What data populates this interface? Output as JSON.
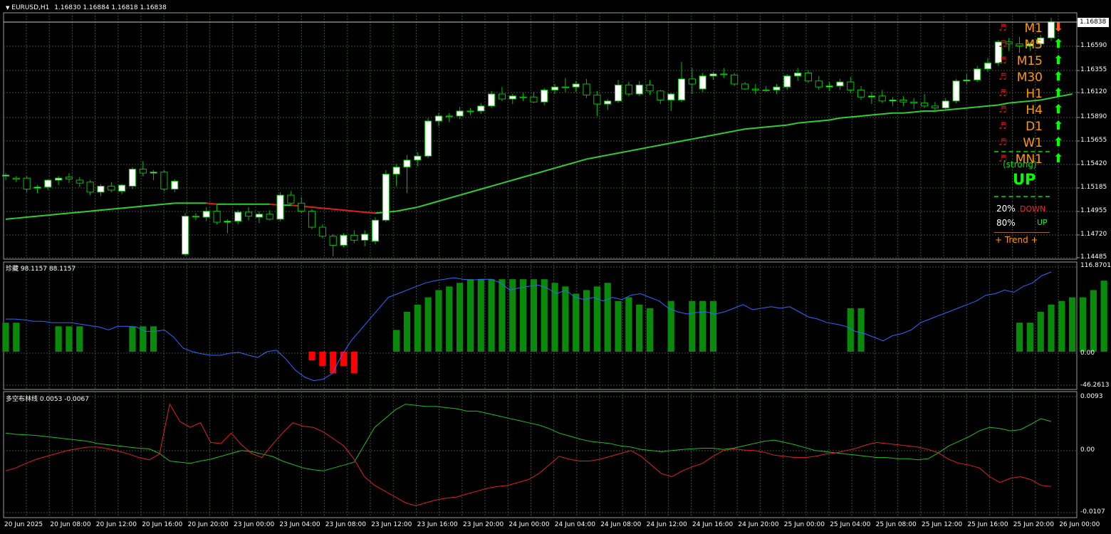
{
  "header": {
    "symbol": "EURUSD,H1",
    "ohlc": "1.16830 1.16884 1.16818 1.16838"
  },
  "colors": {
    "grid": "#3b4f3b",
    "frame": "#9a9a9a",
    "bull": "#ffffff",
    "bear": "#000000",
    "wick": "#00c000",
    "ma_up": "#33cc33",
    "ma_down": "#e02020",
    "blue": "#3366ff",
    "hist_up": "#0a8a0a",
    "hist_down": "#ff0000",
    "green_line": "#22bb22",
    "red_line": "#dd2222",
    "orange": "#ff9900",
    "arrow_up": "#00ff00",
    "arrow_down": "#ff5a1a"
  },
  "main": {
    "price_labels": [
      "1.16838",
      "1.16590",
      "1.16355",
      "1.16120",
      "1.15890",
      "1.15655",
      "1.15420",
      "1.15185",
      "1.14955",
      "1.14720",
      "1.14485"
    ],
    "current_price": "1.16838",
    "panel": {
      "timeframes": [
        {
          "label": "M1",
          "arrow": "down"
        },
        {
          "label": "M5",
          "arrow": "up"
        },
        {
          "label": "M15",
          "arrow": "up"
        },
        {
          "label": "M30",
          "arrow": "up"
        },
        {
          "label": "H1",
          "arrow": "up"
        },
        {
          "label": "H4",
          "arrow": "up"
        },
        {
          "label": "D1",
          "arrow": "up"
        },
        {
          "label": "W1",
          "arrow": "up"
        },
        {
          "label": "MN1",
          "arrow": "up"
        }
      ],
      "music_icon": "♬",
      "strength": "(strong)",
      "direction": "UP",
      "down_pct": "20%",
      "down_label": "DOWN",
      "up_pct": "80%",
      "up_label": "UP",
      "trend": "+  Trend  +"
    }
  },
  "ind1": {
    "title": "珍藏 98.1157 88.1157",
    "labels": [
      "116.8701",
      "0.00",
      "-46.2613"
    ]
  },
  "ind2": {
    "title": "多空布林线 0.0053 -0.0067",
    "labels": [
      "0.0093",
      "0.00",
      "-0.0107"
    ]
  },
  "time_labels": [
    "20 Jun 2025",
    "20 Jun 08:00",
    "20 Jun 12:00",
    "20 Jun 16:00",
    "20 Jun 20:00",
    "23 Jun 00:00",
    "23 Jun 04:00",
    "23 Jun 08:00",
    "23 Jun 12:00",
    "23 Jun 16:00",
    "23 Jun 20:00",
    "24 Jun 00:00",
    "24 Jun 04:00",
    "24 Jun 08:00",
    "24 Jun 12:00",
    "24 Jun 16:00",
    "24 Jun 20:00",
    "25 Jun 00:00",
    "25 Jun 04:00",
    "25 Jun 08:00",
    "25 Jun 12:00",
    "25 Jun 16:00",
    "25 Jun 20:00",
    "26 Jun 00:00"
  ],
  "chart_data": {
    "type": "candlestick",
    "ylim": [
      1.14485,
      1.16838
    ],
    "candles": [
      [
        1.153,
        1.1533,
        1.1526,
        1.1531
      ],
      [
        1.1528,
        1.153,
        1.1524,
        1.1527
      ],
      [
        1.1528,
        1.153,
        1.1514,
        1.1517
      ],
      [
        1.1518,
        1.1521,
        1.1513,
        1.1519
      ],
      [
        1.1519,
        1.1527,
        1.1516,
        1.1526
      ],
      [
        1.1526,
        1.153,
        1.1521,
        1.1528
      ],
      [
        1.1529,
        1.1533,
        1.1523,
        1.1527
      ],
      [
        1.1526,
        1.1529,
        1.1519,
        1.1523
      ],
      [
        1.1524,
        1.1526,
        1.1511,
        1.1514
      ],
      [
        1.1514,
        1.1522,
        1.151,
        1.152
      ],
      [
        1.152,
        1.1524,
        1.1514,
        1.1516
      ],
      [
        1.1515,
        1.1522,
        1.1512,
        1.1521
      ],
      [
        1.152,
        1.1539,
        1.1517,
        1.1537
      ],
      [
        1.1537,
        1.1545,
        1.153,
        1.1533
      ],
      [
        1.1533,
        1.1536,
        1.1526,
        1.1534
      ],
      [
        1.1534,
        1.1536,
        1.1515,
        1.1517
      ],
      [
        1.1517,
        1.1527,
        1.1514,
        1.1525
      ],
      [
        1.1452,
        1.1493,
        1.145,
        1.149
      ],
      [
        1.149,
        1.1493,
        1.1486,
        1.149
      ],
      [
        1.1489,
        1.1499,
        1.1485,
        1.1495
      ],
      [
        1.1495,
        1.1502,
        1.1482,
        1.1484
      ],
      [
        1.1484,
        1.1487,
        1.1473,
        1.1485
      ],
      [
        1.1485,
        1.1496,
        1.1482,
        1.1494
      ],
      [
        1.1494,
        1.1499,
        1.1486,
        1.149
      ],
      [
        1.1489,
        1.1495,
        1.1483,
        1.1492
      ],
      [
        1.1492,
        1.1496,
        1.1486,
        1.1487
      ],
      [
        1.1487,
        1.1514,
        1.1485,
        1.1511
      ],
      [
        1.1511,
        1.1515,
        1.15,
        1.1503
      ],
      [
        1.1503,
        1.1509,
        1.1493,
        1.1495
      ],
      [
        1.1495,
        1.1497,
        1.1477,
        1.1479
      ],
      [
        1.1479,
        1.1482,
        1.1468,
        1.147
      ],
      [
        1.147,
        1.1472,
        1.145,
        1.1461
      ],
      [
        1.1461,
        1.1473,
        1.1459,
        1.1471
      ],
      [
        1.1471,
        1.1476,
        1.1463,
        1.1466
      ],
      [
        1.1466,
        1.1476,
        1.146,
        1.1472
      ],
      [
        1.1465,
        1.1489,
        1.1462,
        1.1486
      ],
      [
        1.1486,
        1.1536,
        1.1484,
        1.1532
      ],
      [
        1.1532,
        1.1542,
        1.152,
        1.1539
      ],
      [
        1.1539,
        1.1551,
        1.1513,
        1.1546
      ],
      [
        1.1546,
        1.1554,
        1.154,
        1.155
      ],
      [
        1.155,
        1.1588,
        1.1548,
        1.1585
      ],
      [
        1.1585,
        1.1593,
        1.158,
        1.159
      ],
      [
        1.159,
        1.1593,
        1.1584,
        1.159
      ],
      [
        1.159,
        1.1599,
        1.1587,
        1.1595
      ],
      [
        1.1595,
        1.1598,
        1.1591,
        1.1595
      ],
      [
        1.1595,
        1.1603,
        1.1592,
        1.16
      ],
      [
        1.16,
        1.1615,
        1.1598,
        1.1612
      ],
      [
        1.1612,
        1.1619,
        1.1605,
        1.1607
      ],
      [
        1.1607,
        1.1612,
        1.1602,
        1.161
      ],
      [
        1.1609,
        1.1613,
        1.1605,
        1.1609
      ],
      [
        1.1609,
        1.1614,
        1.1603,
        1.1604
      ],
      [
        1.1604,
        1.1618,
        1.1601,
        1.1616
      ],
      [
        1.1616,
        1.1622,
        1.1612,
        1.1619
      ],
      [
        1.1619,
        1.1628,
        1.1614,
        1.1619
      ],
      [
        1.1619,
        1.1625,
        1.1614,
        1.1622
      ],
      [
        1.1622,
        1.1627,
        1.1608,
        1.1611
      ],
      [
        1.1611,
        1.1615,
        1.159,
        1.1602
      ],
      [
        1.1602,
        1.1607,
        1.1596,
        1.1605
      ],
      [
        1.1605,
        1.1626,
        1.1603,
        1.1621
      ],
      [
        1.1621,
        1.1624,
        1.161,
        1.1612
      ],
      [
        1.1612,
        1.1625,
        1.161,
        1.1621
      ],
      [
        1.1621,
        1.1626,
        1.1611,
        1.1615
      ],
      [
        1.1615,
        1.1616,
        1.1602,
        1.1606
      ],
      [
        1.1606,
        1.1613,
        1.1595,
        1.1612
      ],
      [
        1.1606,
        1.1644,
        1.1604,
        1.1627
      ],
      [
        1.1627,
        1.1638,
        1.1612,
        1.1622
      ],
      [
        1.1617,
        1.1633,
        1.1614,
        1.163
      ],
      [
        1.163,
        1.1634,
        1.1626,
        1.1632
      ],
      [
        1.1632,
        1.1638,
        1.1628,
        1.1632
      ],
      [
        1.1631,
        1.1633,
        1.162,
        1.1622
      ],
      [
        1.1622,
        1.1624,
        1.1616,
        1.1617
      ],
      [
        1.1617,
        1.1622,
        1.1612,
        1.1616
      ],
      [
        1.1616,
        1.162,
        1.1614,
        1.1616
      ],
      [
        1.1616,
        1.1622,
        1.1612,
        1.1619
      ],
      [
        1.1619,
        1.1632,
        1.1616,
        1.163
      ],
      [
        1.163,
        1.1638,
        1.1625,
        1.1633
      ],
      [
        1.1633,
        1.1636,
        1.1623,
        1.1625
      ],
      [
        1.1625,
        1.163,
        1.1616,
        1.1619
      ],
      [
        1.1619,
        1.1624,
        1.1615,
        1.162
      ],
      [
        1.162,
        1.1627,
        1.1616,
        1.1624
      ],
      [
        1.1624,
        1.1629,
        1.1613,
        1.1616
      ],
      [
        1.1616,
        1.162,
        1.1606,
        1.1609
      ],
      [
        1.1609,
        1.1614,
        1.1602,
        1.161
      ],
      [
        1.161,
        1.1616,
        1.1603,
        1.1605
      ],
      [
        1.1605,
        1.1609,
        1.16,
        1.1606
      ],
      [
        1.1606,
        1.161,
        1.16,
        1.1604
      ],
      [
        1.1604,
        1.1608,
        1.1597,
        1.1603
      ],
      [
        1.1603,
        1.1612,
        1.1598,
        1.16
      ],
      [
        1.16,
        1.1604,
        1.1594,
        1.1598
      ],
      [
        1.1598,
        1.1608,
        1.1595,
        1.1605
      ],
      [
        1.1605,
        1.1627,
        1.1603,
        1.1625
      ],
      [
        1.1625,
        1.1632,
        1.1622,
        1.1626
      ],
      [
        1.1626,
        1.164,
        1.1624,
        1.1637
      ],
      [
        1.1637,
        1.1648,
        1.1634,
        1.1643
      ],
      [
        1.1643,
        1.1666,
        1.164,
        1.1664
      ],
      [
        1.1664,
        1.1668,
        1.1655,
        1.1662
      ],
      [
        1.1662,
        1.1669,
        1.1653,
        1.166
      ],
      [
        1.166,
        1.1664,
        1.1655,
        1.1662
      ],
      [
        1.1662,
        1.1671,
        1.1658,
        1.1668
      ],
      [
        1.1668,
        1.1688,
        1.1665,
        1.1684
      ]
    ],
    "ma": [
      1.1487,
      1.1488,
      1.1489,
      1.149,
      1.1491,
      1.1492,
      1.1493,
      1.1494,
      1.1495,
      1.1496,
      1.1497,
      1.1498,
      1.1499,
      1.15,
      1.1501,
      1.1502,
      1.1503,
      1.1503,
      1.1503,
      1.1503,
      1.1502,
      1.1502,
      1.1502,
      1.1502,
      1.1502,
      1.1502,
      1.1501,
      1.1501,
      1.15,
      1.1499,
      1.1498,
      1.1497,
      1.1496,
      1.1495,
      1.1494,
      1.1493,
      1.1494,
      1.1495,
      1.1497,
      1.1499,
      1.1502,
      1.1505,
      1.1508,
      1.1511,
      1.1514,
      1.1517,
      1.152,
      1.1523,
      1.1526,
      1.1529,
      1.1532,
      1.1535,
      1.1538,
      1.1541,
      1.1544,
      1.1547,
      1.1549,
      1.1551,
      1.1553,
      1.1555,
      1.1557,
      1.1559,
      1.1561,
      1.1563,
      1.1565,
      1.1567,
      1.1569,
      1.1571,
      1.1573,
      1.1575,
      1.1577,
      1.1578,
      1.1579,
      1.158,
      1.1581,
      1.1583,
      1.1584,
      1.1585,
      1.1586,
      1.1588,
      1.1589,
      1.159,
      1.1591,
      1.1592,
      1.1593,
      1.1593,
      1.1594,
      1.1595,
      1.1595,
      1.1596,
      1.1597,
      1.1598,
      1.1599,
      1.16,
      1.1601,
      1.1603,
      1.1604,
      1.1605,
      1.1606,
      1.1608,
      1.161,
      1.1612
    ],
    "ind1_hist": [
      40,
      40,
      0,
      0,
      0,
      35,
      35,
      35,
      0,
      0,
      0,
      0,
      35,
      35,
      35,
      0,
      0,
      0,
      0,
      0,
      0,
      0,
      0,
      0,
      0,
      0,
      0,
      0,
      0,
      -12,
      -20,
      -30,
      -20,
      -30,
      0,
      0,
      0,
      30,
      55,
      65,
      75,
      85,
      90,
      95,
      100,
      100,
      100,
      100,
      100,
      100,
      100,
      100,
      95,
      90,
      80,
      85,
      90,
      95,
      70,
      75,
      65,
      60,
      0,
      70,
      0,
      70,
      70,
      70,
      0,
      0,
      0,
      0,
      0,
      0,
      0,
      0,
      0,
      0,
      0,
      0,
      60,
      60,
      0,
      0,
      0,
      0,
      0,
      0,
      0,
      0,
      0,
      0,
      0,
      0,
      0,
      0,
      40,
      40,
      55,
      65,
      70,
      75,
      75,
      85,
      98,
      98
    ],
    "ind1_line": [
      45,
      45,
      44,
      42,
      42,
      40,
      40,
      40,
      38,
      36,
      34,
      30,
      35,
      35,
      34,
      28,
      28,
      30,
      20,
      5,
      0,
      -3,
      -5,
      -5,
      -2,
      -1,
      -5,
      -8,
      0,
      2,
      -10,
      -25,
      -35,
      -40,
      -38,
      -30,
      -5,
      15,
      30,
      45,
      60,
      75,
      80,
      85,
      90,
      95,
      98,
      100,
      102,
      100,
      99,
      100,
      100,
      95,
      85,
      88,
      90,
      92,
      88,
      80,
      85,
      75,
      72,
      75,
      70,
      75,
      72,
      78,
      80,
      75,
      70,
      60,
      55,
      52,
      54,
      55,
      52,
      55,
      60,
      65,
      58,
      60,
      62,
      60,
      62,
      55,
      48,
      45,
      40,
      38,
      35,
      28,
      25,
      20,
      15,
      22,
      25,
      30,
      40,
      45,
      50,
      55,
      60,
      65,
      70,
      78,
      80,
      85,
      82,
      90,
      95,
      105,
      110
    ],
    "ind2_green": [
      0.003,
      0.0028,
      0.0027,
      0.0026,
      0.0024,
      0.0022,
      0.002,
      0.0018,
      0.0016,
      0.0012,
      0.001,
      0.0008,
      0.0006,
      0.0004,
      0.0003,
      -0.0005,
      -0.0018,
      -0.002,
      -0.0022,
      -0.0018,
      -0.0015,
      -0.001,
      -0.0005,
      0.0,
      -0.0002,
      -0.0006,
      -0.001,
      -0.0018,
      -0.0024,
      -0.003,
      -0.0033,
      -0.0035,
      -0.003,
      -0.0025,
      -0.002,
      0.001,
      0.004,
      0.0055,
      0.007,
      0.008,
      0.0078,
      0.0076,
      0.0076,
      0.0074,
      0.0072,
      0.0068,
      0.0068,
      0.0064,
      0.006,
      0.0056,
      0.0052,
      0.0048,
      0.0044,
      0.0038,
      0.003,
      0.0025,
      0.002,
      0.0016,
      0.0014,
      0.0012,
      0.0008,
      0.0006,
      0.0002,
      0.0,
      -0.0002,
      0.0,
      0.0002,
      0.0003,
      0.0004,
      0.0004,
      0.0002,
      0.0004,
      0.0008,
      0.0012,
      0.0016,
      0.0018,
      0.0014,
      0.001,
      0.0005,
      0.0,
      -0.0002,
      -0.0004,
      -0.0006,
      -0.0008,
      -0.001,
      -0.0012,
      -0.0012,
      -0.0014,
      -0.0014,
      -0.0016,
      -0.0014,
      -0.0004,
      0.0008,
      0.0016,
      0.0024,
      0.0034,
      0.004,
      0.0038,
      0.0034,
      0.0036,
      0.0045,
      0.0055,
      0.005
    ],
    "ind2_red": [
      -0.0035,
      -0.003,
      -0.0022,
      -0.0015,
      -0.001,
      -0.0005,
      0.0,
      0.0003,
      0.0006,
      0.0006,
      0.0003,
      -0.0001,
      -0.0006,
      -0.0012,
      -0.0016,
      -0.0006,
      0.008,
      0.005,
      0.004,
      0.0048,
      0.0014,
      0.0012,
      0.003,
      0.001,
      -0.0005,
      -0.0012,
      0.001,
      0.003,
      0.0048,
      0.0042,
      0.004,
      0.0032,
      0.002,
      0.0008,
      -0.0015,
      -0.0045,
      -0.006,
      -0.007,
      -0.008,
      -0.009,
      -0.0095,
      -0.009,
      -0.0085,
      -0.0082,
      -0.008,
      -0.0075,
      -0.007,
      -0.0065,
      -0.0062,
      -0.006,
      -0.0055,
      -0.005,
      -0.004,
      -0.0025,
      -0.001,
      -0.0015,
      -0.0018,
      -0.0018,
      -0.0015,
      -0.001,
      -0.0005,
      0.0,
      -0.001,
      -0.0025,
      -0.004,
      -0.0045,
      -0.0035,
      -0.0028,
      -0.0022,
      -0.001,
      0.0,
      0.0003,
      0.0001,
      0.0,
      -0.0003,
      -0.0008,
      -0.001,
      -0.0012,
      -0.0012,
      -0.001,
      -0.0006,
      -0.0004,
      0.0,
      0.0004,
      0.001,
      0.0014,
      0.0012,
      0.001,
      0.0008,
      0.0006,
      0.0002,
      -0.0004,
      -0.0015,
      -0.0022,
      -0.0025,
      -0.003,
      -0.0045,
      -0.0055,
      -0.0048,
      -0.0045,
      -0.005,
      -0.006,
      -0.0062
    ]
  }
}
